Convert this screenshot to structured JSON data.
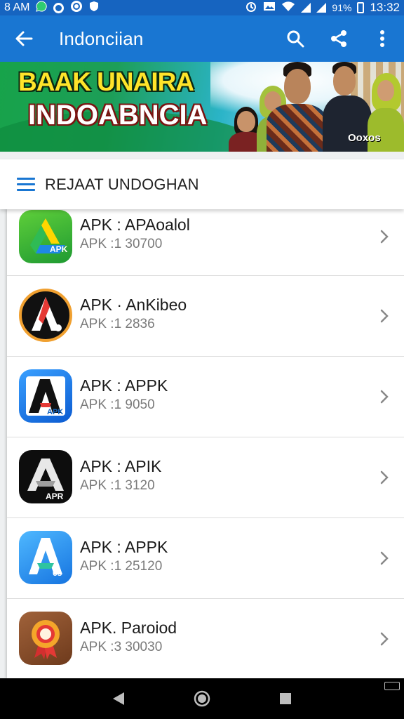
{
  "status_bar": {
    "carrier": "8 AM",
    "battery_percent": "91%",
    "time": "13:32",
    "icons_left": [
      "whatsapp-icon",
      "circle-icon",
      "sync-icon",
      "shield-icon"
    ],
    "icons_right": [
      "alarm-icon",
      "image-icon",
      "wifi-icon",
      "signal-icon",
      "signal-icon",
      "battery-icon"
    ]
  },
  "app_bar": {
    "title": "Indonciian",
    "back_icon": "arrow-left-icon",
    "actions": [
      "search-icon",
      "share-icon",
      "more-vert-icon"
    ],
    "background": "#1976d2"
  },
  "banner": {
    "headline": "BAAK UNAIRA",
    "subheadline": "INDOABNCIA",
    "logo_text": "Ooxos"
  },
  "category_header": {
    "label": "REJAAT UNDOGHAN",
    "icon": "menu-icon"
  },
  "apps": [
    {
      "title": "APK : APAoalol",
      "subtitle": "APK :1  30700",
      "icon": "drive-icon",
      "icon_badge": "APK"
    },
    {
      "title": "APK · AnKibeo",
      "subtitle": "APK :1  2836",
      "icon": "pen-tool-icon",
      "icon_badge": ""
    },
    {
      "title": "APK : APPK",
      "subtitle": "APK :1  9050",
      "icon": "letter-a-icon",
      "icon_badge": "APK"
    },
    {
      "title": "APK : APIK",
      "subtitle": "APK :1  3120",
      "icon": "letter-a-icon",
      "icon_badge": "APR"
    },
    {
      "title": "APK : APPK",
      "subtitle": "APK :1  25120",
      "icon": "letter-a-icon",
      "icon_badge": "6s"
    },
    {
      "title": "APK. Paroiod",
      "subtitle": "APK :3  30030",
      "icon": "award-ribbon-icon",
      "icon_badge": ""
    }
  ],
  "nav_bar": {
    "buttons": [
      "back-icon",
      "home-icon",
      "recents-icon"
    ]
  }
}
